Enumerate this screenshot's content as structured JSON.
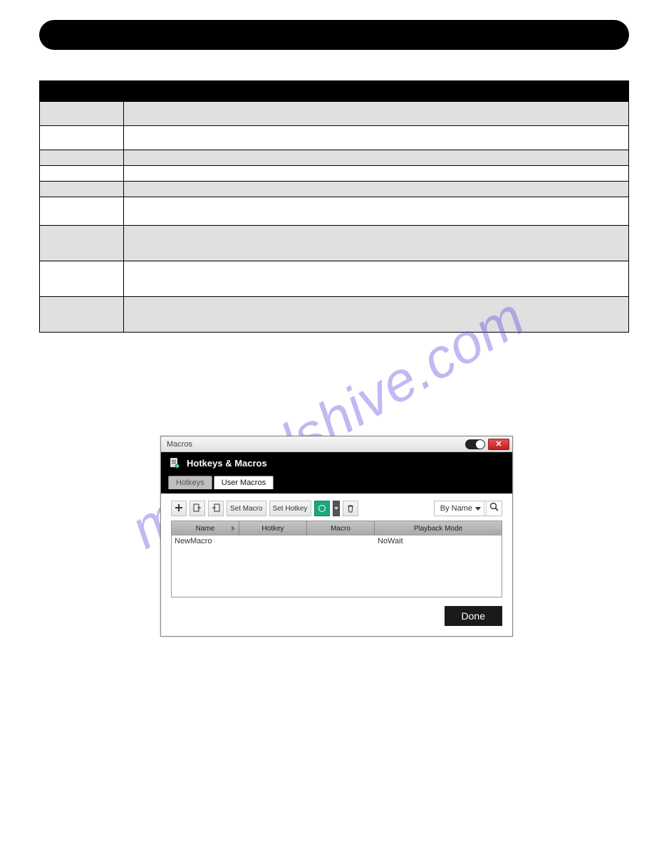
{
  "watermark": "manualshive.com",
  "dialog": {
    "title": "Macros",
    "header": "Hotkeys & Macros",
    "tabs": {
      "hotkeys": "Hotkeys",
      "userMacros": "User Macros"
    },
    "toolbar": {
      "setMacro": "Set Macro",
      "setHotkey": "Set Hotkey",
      "search": {
        "mode": "By Name"
      }
    },
    "grid": {
      "columns": {
        "name": "Name",
        "hotkey": "Hotkey",
        "macro": "Macro",
        "playback": "Playback Mode"
      },
      "rows": [
        {
          "name": "NewMacro",
          "hotkey": "",
          "macro": "",
          "playback": "NoWait"
        }
      ]
    },
    "doneLabel": "Done",
    "closeLabel": "✕"
  }
}
